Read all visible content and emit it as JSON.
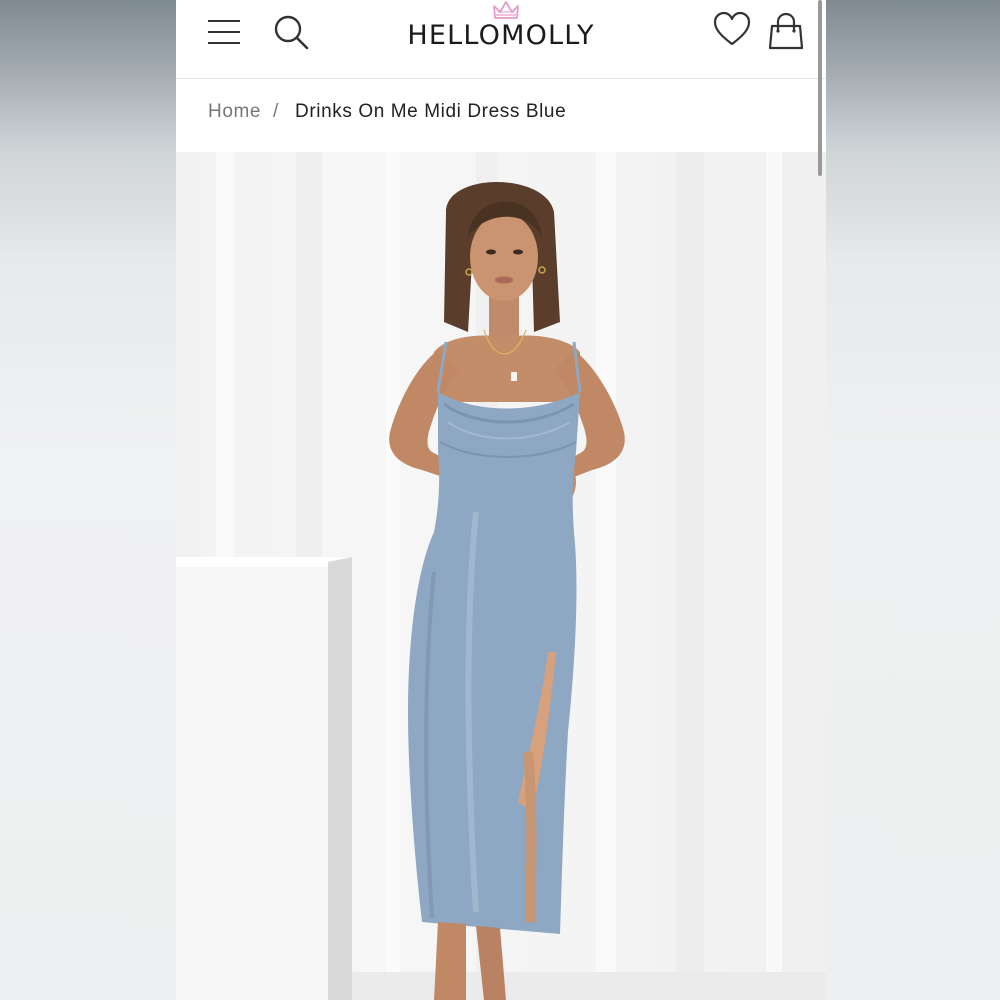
{
  "header": {
    "brand_name": "HELLOMOLLY",
    "menu_icon": "hamburger-menu-icon",
    "search_icon": "search-icon",
    "wishlist_icon": "heart-icon",
    "bag_icon": "shopping-bag-icon"
  },
  "breadcrumb": {
    "home": "Home",
    "separator": "/",
    "current": "Drinks On Me Midi Dress Blue"
  },
  "product": {
    "image_subject": "model wearing blue satin cowl neck midi slip dress",
    "dress_color": "#8ea7c2"
  },
  "colors": {
    "crown_accent": "#e79acb",
    "text_dark": "#222222",
    "text_muted": "#777777"
  }
}
